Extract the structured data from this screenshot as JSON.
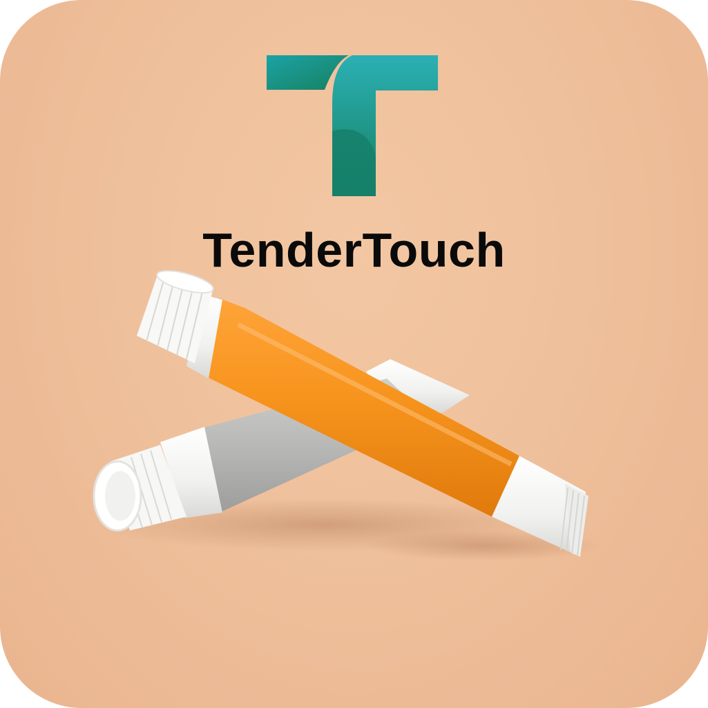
{
  "brand": {
    "name": "TenderTouch",
    "logo_icon": "letter-t-logo-icon",
    "logo_colors": [
      "#1a9e9c",
      "#1a7f62"
    ]
  },
  "background_color": "#efc09c",
  "product_image": {
    "items": [
      "orange-ointment-tube",
      "grey-ointment-tube"
    ],
    "tube_color_primary": "#f7941d",
    "tube_color_secondary": "#b9b9b7",
    "cap_color": "#ffffff"
  }
}
